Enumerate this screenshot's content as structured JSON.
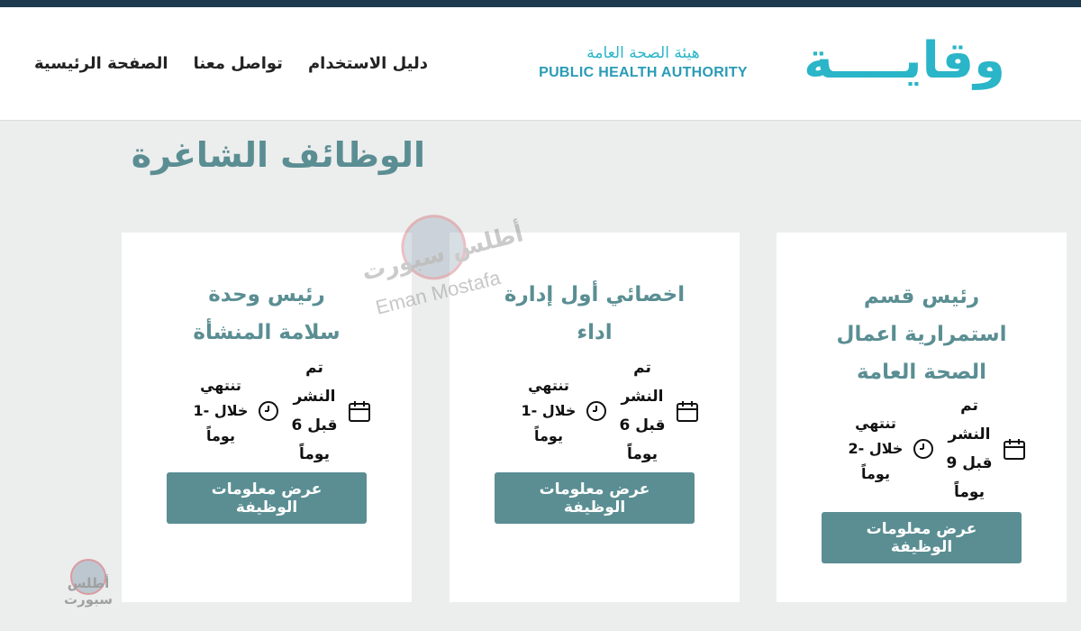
{
  "header": {
    "logo_word": "وقايــــة",
    "logo_arabic": "هيئة الصحة العامة",
    "logo_english": "PUBLIC HEALTH AUTHORITY",
    "nav": [
      {
        "label": "الصفحة الرئيسية"
      },
      {
        "label": "تواصل معنا"
      },
      {
        "label": "دليل الاستخدام"
      }
    ]
  },
  "main": {
    "title": "الوظائف الشاغرة",
    "jobs": [
      {
        "title_lines": [
          "رئيس قسم",
          "استمرارية اعمال",
          "الصحة العامة"
        ],
        "posted_lines": [
          "تم",
          "النشر",
          "قبل 9",
          "يوماً"
        ],
        "ends_lines": [
          "تنتهي",
          "خلال -2",
          "يوماً"
        ],
        "button_lines": [
          "عرض معلومات",
          "الوظيفة"
        ]
      },
      {
        "title_lines": [
          "اخصائي أول إدارة",
          "اداء"
        ],
        "posted_lines": [
          "تم",
          "النشر",
          "قبل 6",
          "يوماً"
        ],
        "ends_lines": [
          "تنتهي",
          "خلال -1",
          "يوماً"
        ],
        "button_lines": [
          "عرض معلومات",
          "الوظيفة"
        ]
      },
      {
        "title_lines": [
          "رئيس وحدة",
          "سلامة المنشأة"
        ],
        "posted_lines": [
          "تم",
          "النشر",
          "قبل 6",
          "يوماً"
        ],
        "ends_lines": [
          "تنتهي",
          "خلال -1",
          "يوماً"
        ],
        "button_lines": [
          "عرض معلومات",
          "الوظيفة"
        ]
      }
    ]
  },
  "watermarks": {
    "atlas": "أطلس سبورت",
    "author": "Eman Mostafa"
  },
  "icons": {
    "posted": "calendar-icon",
    "ends": "clock-icon"
  },
  "colors": {
    "accent": "#5a8e93",
    "brand": "#2ab5c8",
    "topbar": "#1d3a4f",
    "background": "#eceded"
  }
}
